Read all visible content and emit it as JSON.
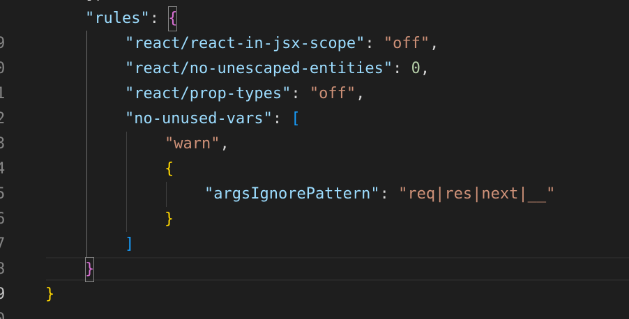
{
  "editor": {
    "line_numbers": [
      "9",
      "0",
      "1",
      "2",
      "3",
      "4",
      "5",
      "6",
      "7",
      "8",
      "9",
      "0"
    ],
    "active_line_index": 10,
    "lines": [
      {
        "tokens": [
          {
            "t": "\"rules\"",
            "c": "key"
          },
          {
            "t": ": ",
            "c": "punc"
          },
          {
            "t": "{",
            "c": "b2",
            "box": true
          }
        ]
      },
      {
        "tokens": [
          {
            "t": "\"react/react-in-jsx-scope\"",
            "c": "key"
          },
          {
            "t": ": ",
            "c": "punc"
          },
          {
            "t": "\"off\"",
            "c": "str"
          },
          {
            "t": ",",
            "c": "punc"
          }
        ]
      },
      {
        "tokens": [
          {
            "t": "\"react/no-unescaped-entities\"",
            "c": "key"
          },
          {
            "t": ": ",
            "c": "punc"
          },
          {
            "t": "0",
            "c": "num"
          },
          {
            "t": ",",
            "c": "punc"
          }
        ]
      },
      {
        "tokens": [
          {
            "t": "\"react/prop-types\"",
            "c": "key"
          },
          {
            "t": ": ",
            "c": "punc"
          },
          {
            "t": "\"off\"",
            "c": "str"
          },
          {
            "t": ",",
            "c": "punc"
          }
        ]
      },
      {
        "tokens": [
          {
            "t": "\"no-unused-vars\"",
            "c": "key"
          },
          {
            "t": ": ",
            "c": "punc"
          },
          {
            "t": "[",
            "c": "b3"
          }
        ]
      },
      {
        "tokens": [
          {
            "t": "\"warn\"",
            "c": "str"
          },
          {
            "t": ",",
            "c": "punc"
          }
        ]
      },
      {
        "tokens": [
          {
            "t": "{",
            "c": "b1"
          }
        ]
      },
      {
        "tokens": [
          {
            "t": "\"argsIgnorePattern\"",
            "c": "key"
          },
          {
            "t": ": ",
            "c": "punc"
          },
          {
            "t": "\"req|res|next|__\"",
            "c": "str"
          }
        ]
      },
      {
        "tokens": [
          {
            "t": "}",
            "c": "b1"
          }
        ]
      },
      {
        "tokens": [
          {
            "t": "]",
            "c": "b3"
          }
        ]
      },
      {
        "tokens": [
          {
            "t": "}",
            "c": "b2",
            "box": true
          }
        ]
      },
      {
        "tokens": [
          {
            "t": "}",
            "c": "b1"
          }
        ]
      }
    ]
  }
}
